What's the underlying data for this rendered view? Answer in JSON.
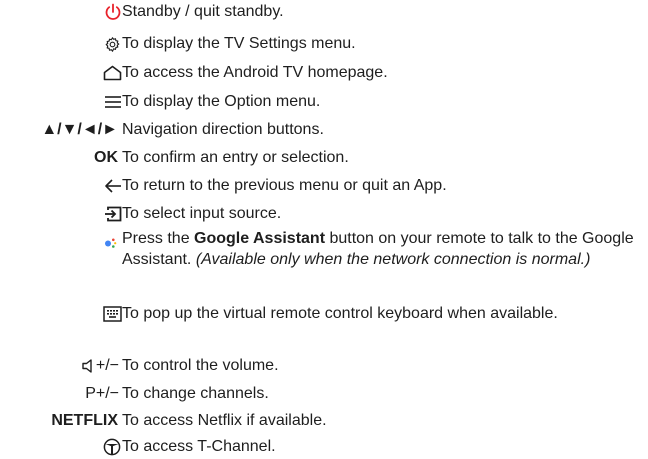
{
  "rows": [
    {
      "icon": "power-icon",
      "text": "Standby / quit standby."
    },
    {
      "icon": "gear-icon",
      "text": "To display the TV Settings menu."
    },
    {
      "icon": "home-icon",
      "text": "To access the Android TV homepage."
    },
    {
      "icon": "menu-icon",
      "text": "To display the Option menu."
    },
    {
      "key": "▲/▼/◄/►",
      "text": "Navigation direction buttons."
    },
    {
      "key": "OK",
      "text": "To confirm an entry or selection."
    },
    {
      "icon": "back-arrow-icon",
      "text": "To return to the previous menu or quit an App."
    },
    {
      "icon": "input-source-icon",
      "text": "To select input source."
    },
    {
      "icon": "google-assistant-icon",
      "text_before": "Press the ",
      "text_bold": "Google Assistant",
      "text_after": " button on your remote to talk to the Google Assistant. ",
      "text_italic": "(Available only when the network connection is normal.)"
    },
    {
      "icon": "keyboard-icon",
      "text": "To pop up the virtual remote control keyboard when available."
    },
    {
      "icon": "volume-icon",
      "key": "+/−",
      "text": "To control the volume."
    },
    {
      "key": "P+/−",
      "text": "To change channels."
    },
    {
      "key": "NETFLIX",
      "text": "To access Netflix if available."
    },
    {
      "icon": "t-channel-icon",
      "text": "To access T-Channel."
    }
  ],
  "colors": {
    "power": "#e8212a",
    "text": "#1e1e1e",
    "ga_blue": "#4285f4",
    "ga_red": "#ea4335",
    "ga_yellow": "#fbbc05",
    "ga_green": "#34a853"
  }
}
